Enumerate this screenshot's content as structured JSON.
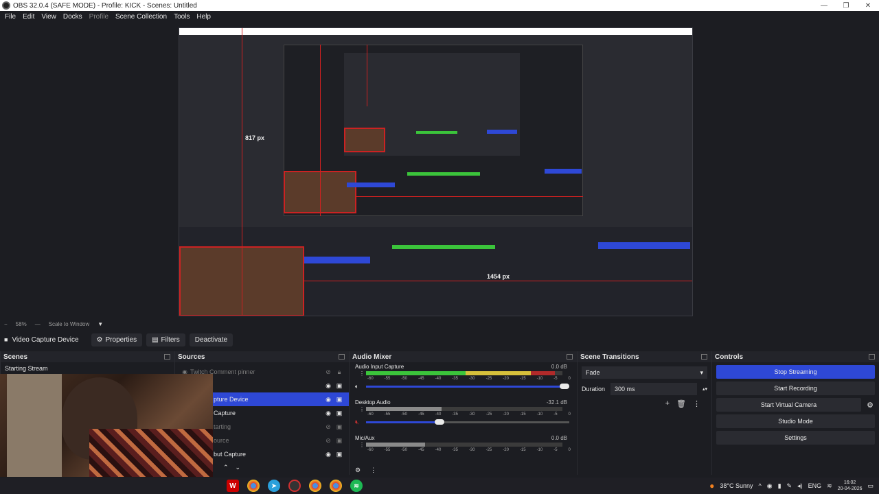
{
  "window": {
    "title": "OBS 32.0.4 (SAFE MODE) - Profile: KICK - Scenes: Untitled",
    "controls": [
      "—",
      "❐",
      "✕"
    ]
  },
  "menu": [
    {
      "label": "File",
      "disabled": false
    },
    {
      "label": "Edit",
      "disabled": false
    },
    {
      "label": "View",
      "disabled": false
    },
    {
      "label": "Docks",
      "disabled": false
    },
    {
      "label": "Profile",
      "disabled": true
    },
    {
      "label": "Scene Collection",
      "disabled": false
    },
    {
      "label": "Tools",
      "disabled": false
    },
    {
      "label": "Help",
      "disabled": false
    }
  ],
  "preview": {
    "height_label": "817 px",
    "width_label": "1454 px"
  },
  "zoom": {
    "value": "58%",
    "mode": "Scale to Window"
  },
  "source_toolbar": {
    "selected_source": "Video Capture Device",
    "properties": "Properties",
    "filters": "Filters",
    "deactivate": "Deactivate"
  },
  "scenes": {
    "header": "Scenes",
    "items": [
      "Starting Stream"
    ]
  },
  "sources": {
    "header": "Sources",
    "items": [
      {
        "label": "Twitch Comment pinner",
        "visible": false,
        "selected": false,
        "dim": true
      },
      {
        "label": "pture Device",
        "visible": true,
        "selected": true,
        "dim": false
      },
      {
        "label": "Capture",
        "visible": true,
        "selected": false,
        "dim": false
      },
      {
        "label": "tarting",
        "visible": false,
        "selected": false,
        "dim": true
      },
      {
        "label": "ource",
        "visible": false,
        "selected": false,
        "dim": true
      },
      {
        "label": "but Capture",
        "visible": true,
        "selected": false,
        "dim": false
      }
    ]
  },
  "mixer": {
    "header": "Audio Mixer",
    "ticks": [
      "-60",
      "-55",
      "-50",
      "-45",
      "-40",
      "-35",
      "-30",
      "-25",
      "-20",
      "-15",
      "-10",
      "-5",
      "0"
    ],
    "channels": [
      {
        "name": "Audio Input Capture",
        "db": "0.0 dB",
        "level": 0.88,
        "muted": false,
        "volume": 1.0
      },
      {
        "name": "Desktop Audio",
        "db": "-32.1 dB",
        "level": 0.4,
        "muted": true,
        "volume": 0.36
      },
      {
        "name": "Mic/Aux",
        "db": "0.0 dB",
        "level": 0.3,
        "muted": false,
        "volume": 1.0
      }
    ]
  },
  "transitions": {
    "header": "Scene Transitions",
    "selected": "Fade",
    "duration_label": "Duration",
    "duration_value": "300 ms"
  },
  "controls": {
    "header": "Controls",
    "stop_streaming": "Stop Streaming",
    "start_recording": "Start Recording",
    "start_virtual_camera": "Start Virtual Camera",
    "studio_mode": "Studio Mode",
    "settings": "Settings"
  },
  "taskbar": {
    "weather": "38°C  Sunny",
    "language": "ENG",
    "time": "16:02",
    "date": "20-04-2026"
  },
  "colors": {
    "accent": "#2e48d6",
    "guide": "#d02020",
    "meter_green": "#3bc43b"
  }
}
